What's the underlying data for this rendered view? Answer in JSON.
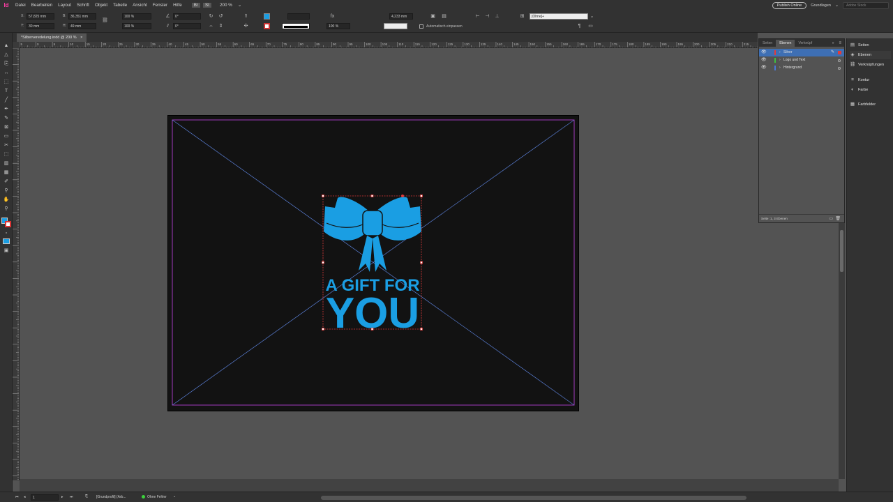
{
  "app": {
    "logo": "Id"
  },
  "menu": [
    "Datei",
    "Bearbeiten",
    "Layout",
    "Schrift",
    "Objekt",
    "Tabelle",
    "Ansicht",
    "Fenster",
    "Hilfe"
  ],
  "zoom_level": "200 %",
  "publish_online_label": "Publish Online",
  "workspace_label": "Grundlagen",
  "search_placeholder": "Adobe Stock",
  "control": {
    "x_label": "X:",
    "x_value": "57,825 mm",
    "y_label": "Y:",
    "y_value": "30 mm",
    "w_label": "B:",
    "w_value": "36,351 mm",
    "h_label": "H:",
    "h_value": "49 mm",
    "scale_x": "100 %",
    "scale_y": "100 %",
    "rotation": "0°",
    "shear": "0°",
    "stroke_weight": "4,233 mm",
    "opacity": "100 %",
    "object_style": "[Ohne]+",
    "auto_fit_label": "Automatisch einpassen"
  },
  "document_tab": "*Silberveredelung.indd @ 200 %",
  "ruler_ticks": [
    "5",
    "0",
    "5",
    "10",
    "15",
    "20",
    "25",
    "30",
    "35",
    "40",
    "45",
    "50",
    "55",
    "60",
    "65",
    "70",
    "75",
    "80",
    "85",
    "90",
    "95",
    "100",
    "105",
    "110",
    "115",
    "120",
    "125",
    "130",
    "135",
    "140",
    "145",
    "150",
    "155",
    "160",
    "165",
    "170",
    "175",
    "180",
    "185",
    "190",
    "195",
    "200",
    "205",
    "210",
    "215"
  ],
  "artwork": {
    "line1": "A GIFT FOR",
    "line2": "YOU",
    "color": "#1a9ee3"
  },
  "layers_panel": {
    "tabs": [
      "Seiten",
      "Ebenen",
      "Verknüpf"
    ],
    "active_tab": "Ebenen",
    "layers": [
      {
        "name": "Silver",
        "color": "#e33b3b",
        "selected": true
      },
      {
        "name": "Logo und Text",
        "color": "#3fbf3f",
        "selected": false
      },
      {
        "name": "Hintergrund",
        "color": "#4a78d8",
        "selected": false
      }
    ],
    "footer": "Seite: 1, 3 Ebenen"
  },
  "dock": [
    {
      "label": "Seiten",
      "icon": "pages-icon"
    },
    {
      "label": "Ebenen",
      "icon": "layers-icon"
    },
    {
      "label": "Verknüpfungen",
      "icon": "links-icon"
    },
    {
      "label": "Kontur",
      "icon": "stroke-icon"
    },
    {
      "label": "Farbe",
      "icon": "color-icon"
    },
    {
      "label": "Farbfelder",
      "icon": "swatches-icon"
    }
  ],
  "status": {
    "page": "1",
    "master": "[Grundprofil] (Arb...",
    "errors": "Ohne Fehler"
  }
}
